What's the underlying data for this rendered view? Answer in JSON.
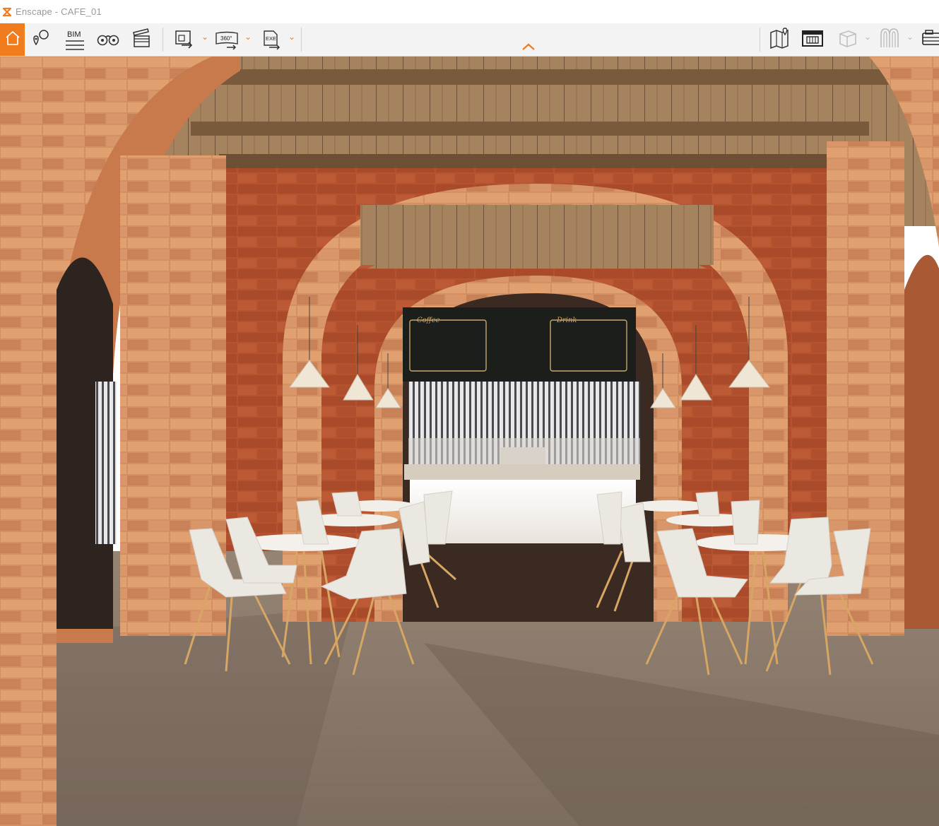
{
  "window": {
    "title": "Enscape - CAFE_01",
    "logo_icon": "enscape-logo-icon"
  },
  "toolbar": {
    "left_group": [
      {
        "name": "home-button",
        "icon": "house-icon",
        "active": true
      },
      {
        "name": "views-button",
        "icon": "map-pin-icon"
      },
      {
        "name": "bim-button",
        "icon": "bim-icon",
        "label": "BIM"
      },
      {
        "name": "binoculars-button",
        "icon": "binoculars-icon"
      },
      {
        "name": "video-editor-button",
        "icon": "clapperboard-icon"
      }
    ],
    "export_group": [
      {
        "name": "render-export-button",
        "icon": "image-export-icon"
      },
      {
        "name": "panorama-export-button",
        "icon": "panorama-360-icon",
        "label": "360°"
      },
      {
        "name": "exe-export-button",
        "icon": "exe-export-icon",
        "label": "EXE"
      }
    ],
    "right_group": [
      {
        "name": "map-button",
        "icon": "map-location-icon"
      },
      {
        "name": "asset-library-button",
        "icon": "asset-library-icon"
      },
      {
        "name": "view-cube-button",
        "icon": "cube-icon"
      },
      {
        "name": "settings-button",
        "icon": "settings-icon"
      },
      {
        "name": "screenshot-button",
        "icon": "camera-icon"
      }
    ],
    "accent_color": "#f07c1e",
    "collapse_icon": "chevron-up-icon"
  },
  "viewport": {
    "scene": "rendered cafe interior with brick arches",
    "menu_boards": [
      {
        "label": "Coffee"
      },
      {
        "label": "Drink"
      }
    ],
    "colors": {
      "brick": "#b5532f",
      "wood": "#a07a55",
      "floor": "#8a7868",
      "chair": "#ebe8e2"
    }
  }
}
